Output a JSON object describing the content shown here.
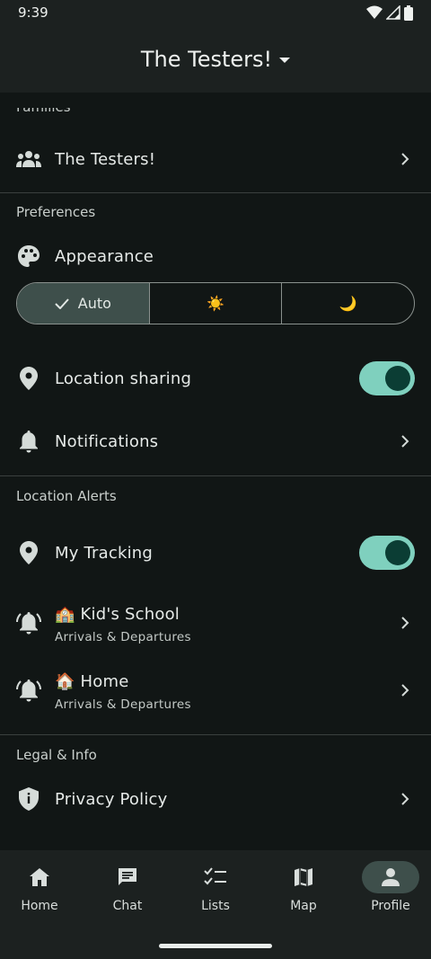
{
  "status_bar": {
    "time": "9:39"
  },
  "app_bar": {
    "title": "The Testers!"
  },
  "families": {
    "section_title": "Families",
    "family_name": "The Testers!"
  },
  "preferences": {
    "section_title": "Preferences",
    "appearance_label": "Appearance",
    "appearance_options": [
      {
        "label": "Auto",
        "selected": true
      },
      {
        "label": "☀️",
        "selected": false
      },
      {
        "label": "🌙",
        "selected": false
      }
    ],
    "location_sharing_label": "Location sharing",
    "location_sharing_on": true,
    "notifications_label": "Notifications"
  },
  "location_alerts": {
    "section_title": "Location Alerts",
    "my_tracking_label": "My Tracking",
    "my_tracking_on": true,
    "places": [
      {
        "emoji": "🏫",
        "name": "Kid's School",
        "subtitle": "Arrivals & Departures"
      },
      {
        "emoji": "🏠",
        "name": "Home",
        "subtitle": "Arrivals & Departures"
      }
    ]
  },
  "legal": {
    "section_title": "Legal & Info",
    "privacy_policy_label": "Privacy Policy"
  },
  "bottom_nav": {
    "items": [
      {
        "label": "Home",
        "icon": "home-icon",
        "active": false
      },
      {
        "label": "Chat",
        "icon": "chat-icon",
        "active": false
      },
      {
        "label": "Lists",
        "icon": "checklist-icon",
        "active": false
      },
      {
        "label": "Map",
        "icon": "map-icon",
        "active": false
      },
      {
        "label": "Profile",
        "icon": "person-icon",
        "active": true
      }
    ]
  },
  "colors": {
    "background": "#111615",
    "surface": "#1c2120",
    "toggle_track": "#7fd0be",
    "toggle_knob": "#0b3d34",
    "selected_segment": "#3e4f4b"
  }
}
